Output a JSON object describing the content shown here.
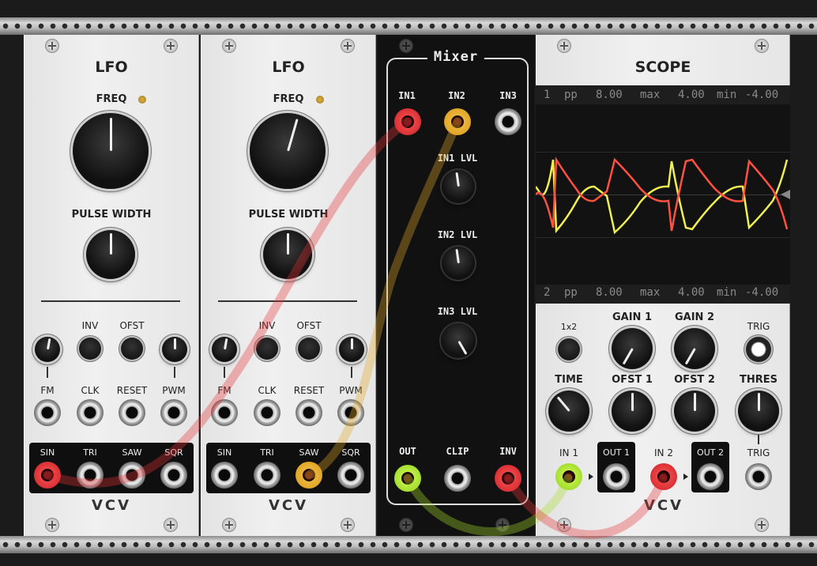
{
  "lfo1": {
    "title": "LFO",
    "freq_label": "FREQ",
    "pulse_width_label": "PULSE WIDTH",
    "inv_label": "INV",
    "ofst_label": "OFST",
    "fm_label": "FM",
    "clk_label": "CLK",
    "reset_label": "RESET",
    "pwm_label": "PWM",
    "outputs": [
      "SIN",
      "TRI",
      "SAW",
      "SQR"
    ],
    "brand": "VCV"
  },
  "lfo2": {
    "title": "LFO",
    "freq_label": "FREQ",
    "pulse_width_label": "PULSE WIDTH",
    "inv_label": "INV",
    "ofst_label": "OFST",
    "fm_label": "FM",
    "clk_label": "CLK",
    "reset_label": "RESET",
    "pwm_label": "PWM",
    "outputs": [
      "SIN",
      "TRI",
      "SAW",
      "SQR"
    ],
    "brand": "VCV"
  },
  "mixer": {
    "title": "Mixer",
    "in1": "IN1",
    "in2": "IN2",
    "in3": "IN3",
    "in1_lvl": "IN1 LVL",
    "in2_lvl": "IN2 LVL",
    "in3_lvl": "IN3 LVL",
    "out": "OUT",
    "clip": "CLIP",
    "inv": "INV"
  },
  "scope": {
    "title": "SCOPE",
    "ch1_readout": {
      "ch": "1",
      "pp_label": "pp",
      "pp": "8.00",
      "max_label": "max",
      "max": "4.00",
      "min_label": "min",
      "min": "-4.00"
    },
    "ch2_readout": {
      "ch": "2",
      "pp_label": "pp",
      "pp": "8.00",
      "max_label": "max",
      "max": "4.00",
      "min_label": "min",
      "min": "-4.00"
    },
    "mode_label": "1x2",
    "gain1": "GAIN 1",
    "gain2": "GAIN 2",
    "trig_label": "TRIG",
    "time": "TIME",
    "ofst1": "OFST 1",
    "ofst2": "OFST 2",
    "thres": "THRES",
    "in1": "IN 1",
    "out1": "OUT 1",
    "in2": "IN 2",
    "out2": "OUT 2",
    "trig_in": "TRIG",
    "brand": "VCV"
  },
  "colors": {
    "cable_red": "#e8353a",
    "cable_yellow": "#e6a82a",
    "cable_green": "#a8e02a",
    "scope_trace1": "#f0f050",
    "scope_trace2": "#ff5040",
    "panel_silver": "#ececec",
    "mixer_black": "#121212"
  }
}
